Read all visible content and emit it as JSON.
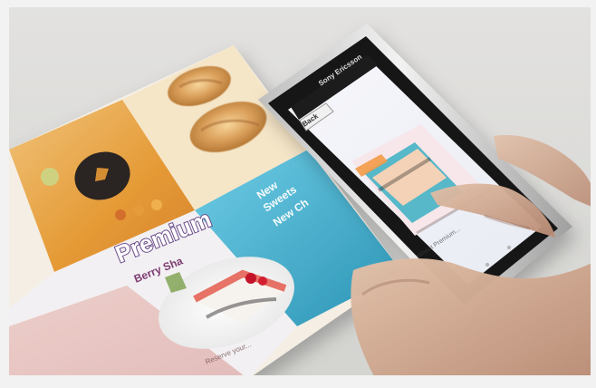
{
  "menu": {
    "headline": "Premium",
    "subline": "Berry Sha",
    "promo_line1": "New",
    "promo_line2": "Sweets",
    "promo_line3": "New Ch",
    "footer_text": "Reserve your..."
  },
  "phone": {
    "brand_text": "Sony Ericsson",
    "back_button": "Back",
    "caption": "Wheat Premium..."
  },
  "colors": {
    "menu_orange": "#e59a35",
    "menu_red": "#c64a3a",
    "menu_cyan": "#39a9c9",
    "phone_black": "#141414",
    "phone_silver": "#d9d9d9",
    "skin": "#caa28a"
  }
}
